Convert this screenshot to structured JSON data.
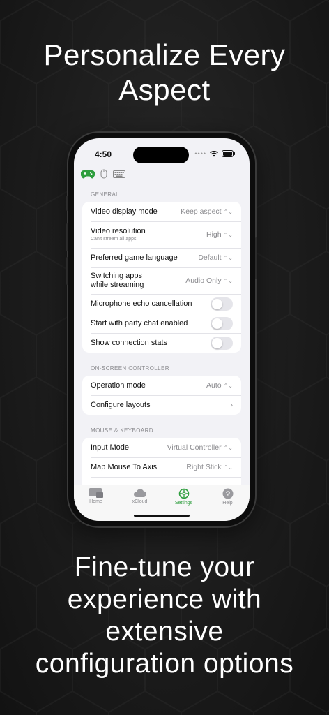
{
  "headline_top": [
    "Personalize Every",
    "Aspect"
  ],
  "headline_bottom": [
    "Fine-tune your",
    "experience with",
    "extensive",
    "configuration options"
  ],
  "status": {
    "time": "4:50"
  },
  "sections": {
    "general": {
      "label": "GENERAL",
      "rows": [
        {
          "label": "Video display mode",
          "value": "Keep aspect"
        },
        {
          "label": "Video resolution",
          "sublabel": "Can't stream all apps",
          "value": "High"
        },
        {
          "label": "Preferred game language",
          "value": "Default"
        },
        {
          "label_line1": "Switching apps",
          "label_line2": "while streaming",
          "value": "Audio Only"
        },
        {
          "label": "Microphone echo cancellation",
          "toggle": false
        },
        {
          "label": "Start with party chat enabled",
          "toggle": false
        },
        {
          "label": "Show connection stats",
          "toggle": false
        }
      ]
    },
    "controller": {
      "label": "ON-SCREEN CONTROLLER",
      "rows": [
        {
          "label": "Operation mode",
          "value": "Auto"
        },
        {
          "label": "Configure layouts"
        }
      ]
    },
    "mouse": {
      "label": "MOUSE & KEYBOARD",
      "rows": [
        {
          "label": "Input Mode",
          "value": "Virtual Controller"
        },
        {
          "label": "Map Mouse To Axis",
          "value": "Right Stick"
        }
      ]
    }
  },
  "tabs": [
    {
      "label": "Home",
      "icon": "home-icon",
      "active": false
    },
    {
      "label": "xCloud",
      "icon": "cloud-icon",
      "active": false
    },
    {
      "label": "Settings",
      "icon": "settings-icon",
      "active": true
    },
    {
      "label": "Help",
      "icon": "help-icon",
      "active": false
    }
  ],
  "colors": {
    "accent": "#2e9e3e",
    "background": "#1c1c1c",
    "screen": "#f2f2f6"
  }
}
